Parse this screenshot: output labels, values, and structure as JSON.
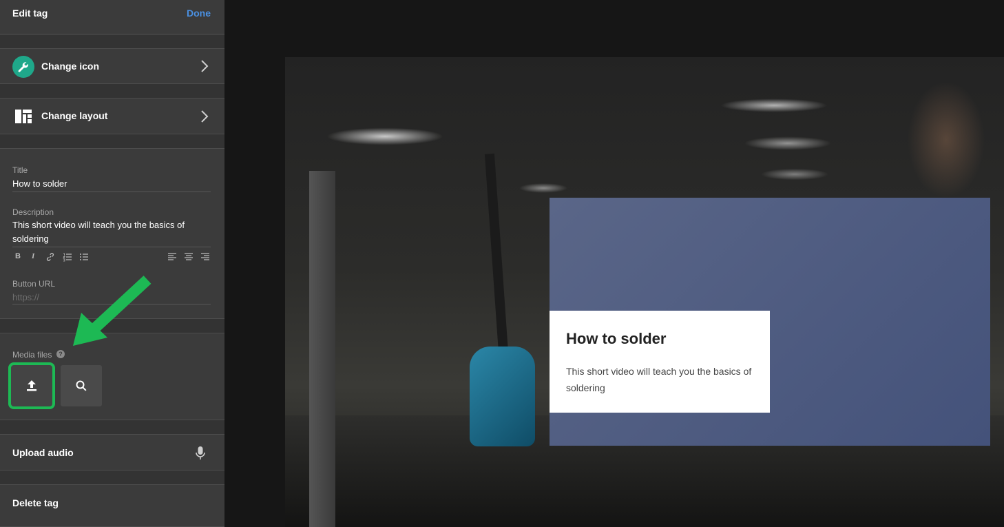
{
  "panel": {
    "title": "Edit tag",
    "done_label": "Done"
  },
  "change_icon": {
    "label": "Change icon",
    "icon": "wrench-icon",
    "icon_color": "#1fa88a"
  },
  "change_layout": {
    "label": "Change layout",
    "icon": "layout-icon"
  },
  "form": {
    "title_label": "Title",
    "title_value": "How to solder",
    "description_label": "Description",
    "description_value": "This short video will teach you the basics of soldering",
    "toolbar": [
      "B",
      "I",
      "link",
      "ordered-list",
      "bullet-list",
      "align-left",
      "align-center",
      "align-right"
    ],
    "url_label": "Button URL",
    "url_placeholder": "https://"
  },
  "media": {
    "label": "Media files",
    "help": "?",
    "highlight_color": "#1db954"
  },
  "upload_audio": {
    "label": "Upload audio",
    "icon": "microphone-icon"
  },
  "delete_tag": {
    "label": "Delete tag"
  },
  "preview": {
    "overlay_color": "#4f5c80",
    "card_title": "How to solder",
    "card_description": "This short video will teach you the basics of soldering"
  }
}
